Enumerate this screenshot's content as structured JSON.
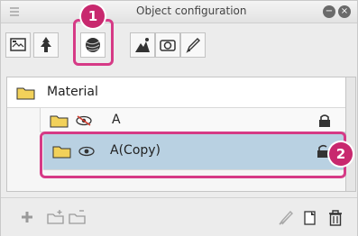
{
  "window": {
    "title": "Object configuration",
    "minimize_glyph": "−",
    "close_glyph": "×"
  },
  "toolbar": {
    "buttons": [
      {
        "name": "frame-icon"
      },
      {
        "name": "tree-icon"
      },
      {
        "name": "sphere-texture-icon",
        "selected": true
      },
      {
        "name": "landscape-icon"
      },
      {
        "name": "camera-icon"
      },
      {
        "name": "pen-icon"
      }
    ]
  },
  "callouts": {
    "first": "1",
    "second": "2",
    "color": "#d63a86"
  },
  "layers": {
    "folder": {
      "label": "Material"
    },
    "item_a": {
      "label": "A",
      "visibility": "hidden",
      "locked": true
    },
    "item_copy": {
      "label": "A(Copy)",
      "visibility": "visible",
      "locked": false,
      "selected": true
    }
  },
  "colors": {
    "selection": "#b9d1e2",
    "folder": "#f2d15a"
  },
  "bottom_toolbar": {
    "icons": [
      "add-icon",
      "new-folder-icon",
      "new-folder-alt-icon",
      "brush-icon",
      "copy-icon",
      "trash-icon"
    ]
  }
}
